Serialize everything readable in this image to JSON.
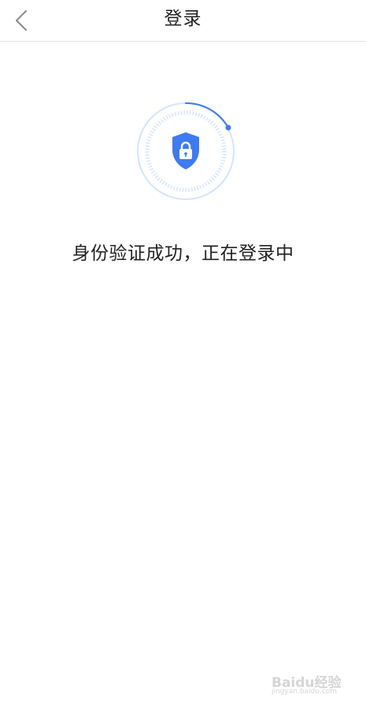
{
  "header": {
    "title": "登录",
    "back_icon": "chevron-left-icon"
  },
  "status": {
    "message": "身份验证成功，正在登录中",
    "icon": "shield-lock-icon",
    "accent_color": "#3e7bf0"
  },
  "watermark": {
    "brand": "Baidu经验",
    "url": "jingyan.baidu.com"
  }
}
